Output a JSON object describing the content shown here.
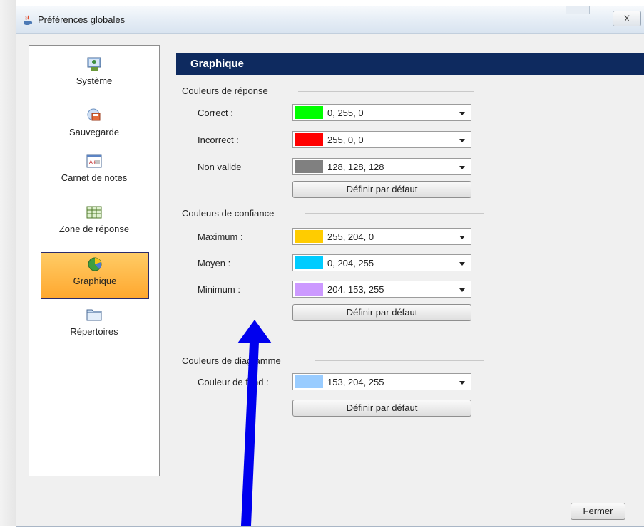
{
  "window": {
    "title": "Préférences globales",
    "close_label": "X",
    "footer_button": "Fermer"
  },
  "sidebar": {
    "items": [
      {
        "label": "Système",
        "icon": "system-icon",
        "active": false
      },
      {
        "label": "Sauvegarde",
        "icon": "save-icon",
        "active": false
      },
      {
        "label": "Carnet de notes",
        "icon": "gradebook-icon",
        "active": false
      },
      {
        "label": "Zone de réponse",
        "icon": "answer-zone-icon",
        "active": false
      },
      {
        "label": "Graphique",
        "icon": "chart-icon",
        "active": true
      },
      {
        "label": "Répertoires",
        "icon": "folder-icon",
        "active": false
      }
    ]
  },
  "main": {
    "header": "Graphique",
    "groups": [
      {
        "title": "Couleurs de réponse",
        "rows": [
          {
            "label": "Correct :",
            "value": "0, 255, 0",
            "color": "#00ff00"
          },
          {
            "label": "Incorrect :",
            "value": "255, 0, 0",
            "color": "#ff0000"
          },
          {
            "label": "Non valide",
            "value": "128, 128, 128",
            "color": "#808080"
          }
        ],
        "default_button": "Définir par défaut"
      },
      {
        "title": "Couleurs de confiance",
        "rows": [
          {
            "label": "Maximum :",
            "value": "255, 204, 0",
            "color": "#ffcc00"
          },
          {
            "label": "Moyen :",
            "value": "0, 204, 255",
            "color": "#00ccff"
          },
          {
            "label": "Minimum :",
            "value": "204, 153, 255",
            "color": "#cc99ff"
          }
        ],
        "default_button": "Définir par défaut"
      },
      {
        "title": "Couleurs de diagramme",
        "rows": [
          {
            "label": "Couleur de fond :",
            "value": "153, 204, 255",
            "color": "#99ccff"
          }
        ],
        "default_button": "Définir par défaut"
      }
    ]
  },
  "annotation_arrow_color": "#0000ee"
}
